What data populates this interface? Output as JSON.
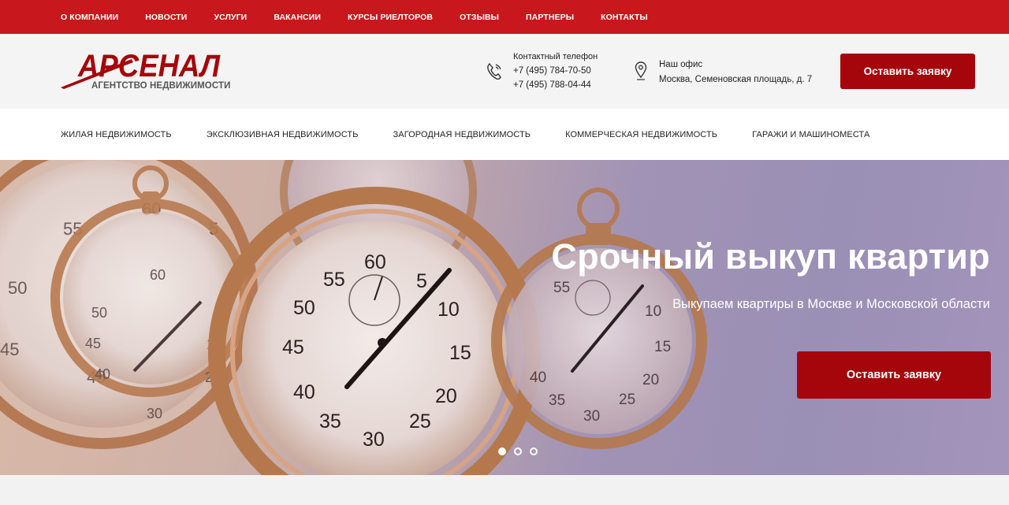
{
  "top_nav": {
    "items": [
      {
        "label": "О компании"
      },
      {
        "label": "Новости"
      },
      {
        "label": "Услуги"
      },
      {
        "label": "Вакансии"
      },
      {
        "label": "Курсы риелторов"
      },
      {
        "label": "Отзывы"
      },
      {
        "label": "Партнеры"
      },
      {
        "label": "Контакты"
      }
    ]
  },
  "header": {
    "logo_text": "АРСЕНАЛ",
    "logo_sub": "АГЕНТСТВО НЕДВИЖИМОСТИ",
    "contact": {
      "title": "Контактный телефон",
      "phone1": "+7 (495) 784-70-50",
      "phone2": "+7 (495) 788-04-44"
    },
    "office": {
      "title": "Наш офис",
      "address": "Москва, Семеновская площадь, д. 7"
    },
    "cta_label": "Оставить заявку"
  },
  "category_nav": {
    "items": [
      {
        "label": "Жилая недвижимость"
      },
      {
        "label": "Эксклюзивная недвижимость"
      },
      {
        "label": "Загородная недвижимость"
      },
      {
        "label": "Коммерческая недвижимость"
      },
      {
        "label": "Гаражи и машиноместа"
      }
    ]
  },
  "hero": {
    "title": "Срочный выкуп квартир",
    "subtitle": "Выкупаем квартиры в Москве и Московской области",
    "cta_label": "Оставить заявку",
    "slide_count": 3,
    "active_slide": 1
  },
  "colors": {
    "brand_red": "#c8181d",
    "button_red": "#a5060b"
  }
}
